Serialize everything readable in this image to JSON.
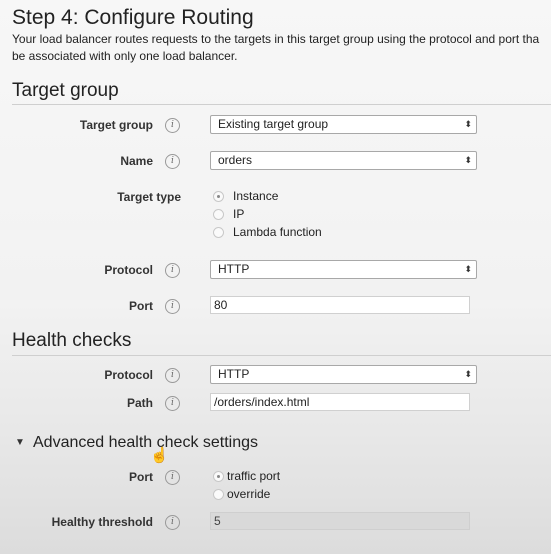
{
  "page": {
    "title": "Step 4: Configure Routing",
    "intro_line1": "Your load balancer routes requests to the targets in this target group using the protocol and port tha",
    "intro_line2": "be associated with only one load balancer."
  },
  "target_group": {
    "heading": "Target group",
    "target_group_label": "Target group",
    "target_group_value": "Existing target group",
    "name_label": "Name",
    "name_value": "orders",
    "target_type_label": "Target type",
    "target_type_options": [
      "Instance",
      "IP",
      "Lambda function"
    ],
    "target_type_selected": "Instance",
    "protocol_label": "Protocol",
    "protocol_value": "HTTP",
    "port_label": "Port",
    "port_value": "80"
  },
  "health_checks": {
    "heading": "Health checks",
    "protocol_label": "Protocol",
    "protocol_value": "HTTP",
    "path_label": "Path",
    "path_value": "/orders/index.html"
  },
  "advanced": {
    "heading": "Advanced health check settings",
    "port_label": "Port",
    "port_options": [
      "traffic port",
      "override"
    ],
    "port_selected": "traffic port",
    "healthy_threshold_label": "Healthy threshold",
    "healthy_threshold_value": "5"
  },
  "icons": {
    "info": "info-icon",
    "select_arrows": "select-arrows-icon",
    "disclosure": "caret-down-icon",
    "cursor": "hand-pointer-icon"
  },
  "glyphs": {
    "info": "i",
    "arrows": "⬍",
    "caret": "▼",
    "hand": "☝"
  }
}
